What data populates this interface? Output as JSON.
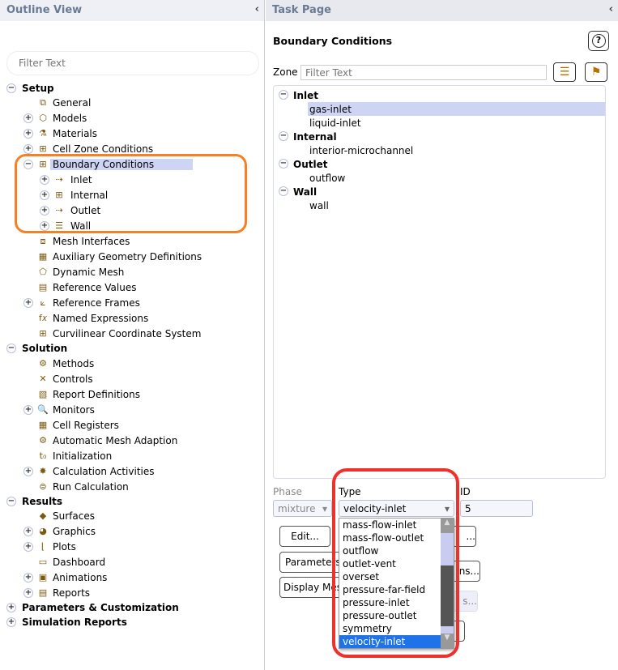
{
  "outline": {
    "title": "Outline View",
    "collapse": "‹",
    "filter_placeholder": "Filter Text",
    "items": [
      {
        "label": "Setup",
        "level": 0,
        "exp": "−",
        "bold": true
      },
      {
        "label": "General",
        "level": 1,
        "icon": "general-icon",
        "glyph": "⧉"
      },
      {
        "label": "Models",
        "level": 1,
        "exp": "+",
        "icon": "models-icon",
        "glyph": "⬡"
      },
      {
        "label": "Materials",
        "level": 1,
        "exp": "+",
        "icon": "materials-icon",
        "glyph": "⚗"
      },
      {
        "label": "Cell Zone Conditions",
        "level": 1,
        "exp": "+",
        "icon": "cell-zone-icon",
        "glyph": "⊞"
      },
      {
        "label": "Boundary Conditions",
        "level": 1,
        "exp": "−",
        "icon": "boundary-conditions-icon",
        "glyph": "⊞",
        "selected": true
      },
      {
        "label": "Inlet",
        "level": 2,
        "exp": "+",
        "icon": "inlet-icon",
        "glyph": "⇢"
      },
      {
        "label": "Internal",
        "level": 2,
        "exp": "+",
        "icon": "internal-icon",
        "glyph": "⊞"
      },
      {
        "label": "Outlet",
        "level": 2,
        "exp": "+",
        "icon": "outlet-icon",
        "glyph": "⇢"
      },
      {
        "label": "Wall",
        "level": 2,
        "exp": "+",
        "icon": "wall-icon",
        "glyph": "☰"
      },
      {
        "label": "Mesh Interfaces",
        "level": 1,
        "icon": "mesh-interfaces-icon",
        "glyph": "⧈"
      },
      {
        "label": "Auxiliary Geometry Definitions",
        "level": 1,
        "icon": "aux-geometry-icon",
        "glyph": "▦"
      },
      {
        "label": "Dynamic Mesh",
        "level": 1,
        "icon": "dynamic-mesh-icon",
        "glyph": "⬠"
      },
      {
        "label": "Reference Values",
        "level": 1,
        "icon": "reference-values-icon",
        "glyph": "▤"
      },
      {
        "label": "Reference Frames",
        "level": 1,
        "exp": "+",
        "icon": "reference-frames-icon",
        "glyph": "⟀"
      },
      {
        "label": "Named Expressions",
        "level": 1,
        "icon": "fx-icon",
        "glyph": "f𝑥"
      },
      {
        "label": "Curvilinear Coordinate System",
        "level": 1,
        "icon": "curvilinear-icon",
        "glyph": "⊞"
      },
      {
        "label": "Solution",
        "level": 0,
        "exp": "−",
        "bold": true
      },
      {
        "label": "Methods",
        "level": 1,
        "icon": "methods-icon",
        "glyph": "⚙"
      },
      {
        "label": "Controls",
        "level": 1,
        "icon": "controls-icon",
        "glyph": "✕"
      },
      {
        "label": "Report Definitions",
        "level": 1,
        "icon": "report-definitions-icon",
        "glyph": "▧"
      },
      {
        "label": "Monitors",
        "level": 1,
        "exp": "+",
        "icon": "monitors-icon",
        "glyph": "🔍"
      },
      {
        "label": "Cell Registers",
        "level": 1,
        "icon": "cell-registers-icon",
        "glyph": "▦"
      },
      {
        "label": "Automatic Mesh Adaption",
        "level": 1,
        "icon": "mesh-adaption-icon",
        "glyph": "⚙"
      },
      {
        "label": "Initialization",
        "level": 1,
        "icon": "initialization-icon",
        "glyph": "t₀"
      },
      {
        "label": "Calculation Activities",
        "level": 1,
        "exp": "+",
        "icon": "calculation-activities-icon",
        "glyph": "✸"
      },
      {
        "label": "Run Calculation",
        "level": 1,
        "icon": "run-calculation-icon",
        "glyph": "⊜"
      },
      {
        "label": "Results",
        "level": 0,
        "exp": "−",
        "bold": true
      },
      {
        "label": "Surfaces",
        "level": 1,
        "icon": "surfaces-icon",
        "glyph": "◆"
      },
      {
        "label": "Graphics",
        "level": 1,
        "exp": "+",
        "icon": "graphics-icon",
        "glyph": "◕"
      },
      {
        "label": "Plots",
        "level": 1,
        "exp": "+",
        "icon": "plots-icon",
        "glyph": "⌊"
      },
      {
        "label": "Dashboard",
        "level": 1,
        "icon": "dashboard-icon",
        "glyph": "▭"
      },
      {
        "label": "Animations",
        "level": 1,
        "exp": "+",
        "icon": "animations-icon",
        "glyph": "▣"
      },
      {
        "label": "Reports",
        "level": 1,
        "exp": "+",
        "icon": "reports-icon",
        "glyph": "▤"
      },
      {
        "label": "Parameters & Customization",
        "level": 0,
        "exp": "+",
        "bold": true
      },
      {
        "label": "Simulation Reports",
        "level": 0,
        "exp": "+",
        "bold": true
      }
    ]
  },
  "task": {
    "title": "Task Page",
    "collapse": "‹",
    "heading": "Boundary Conditions",
    "help": "?",
    "zone_label": "Zone",
    "zone_filter_placeholder": "Filter Text",
    "zones": [
      {
        "label": "Inlet",
        "group": true
      },
      {
        "label": "gas-inlet",
        "selected": true
      },
      {
        "label": "liquid-inlet"
      },
      {
        "label": "Internal",
        "group": true
      },
      {
        "label": "interior-microchannel"
      },
      {
        "label": "Outlet",
        "group": true
      },
      {
        "label": "outflow"
      },
      {
        "label": "Wall",
        "group": true
      },
      {
        "label": "wall"
      }
    ],
    "phase_label": "Phase",
    "phase_value": "mixture",
    "type_label": "Type",
    "type_value": "velocity-inlet",
    "id_label": "ID",
    "id_value": "5",
    "buttons": {
      "edit": "Edit...",
      "copy": "...",
      "parameters": "Parameters...",
      "operating": "ns...",
      "display_mesh": "Display Mesh...",
      "periodic": "s...",
      "last": ""
    },
    "type_options": [
      "mass-flow-inlet",
      "mass-flow-outlet",
      "outflow",
      "outlet-vent",
      "overset",
      "pressure-far-field",
      "pressure-inlet",
      "pressure-outlet",
      "symmetry",
      "velocity-inlet"
    ],
    "type_selected": "velocity-inlet"
  },
  "colors": {
    "accent_orange": "#f58025",
    "accent_red": "#f0302a",
    "selection": "#cdd4f4",
    "list_selection": "#1e73e8"
  }
}
